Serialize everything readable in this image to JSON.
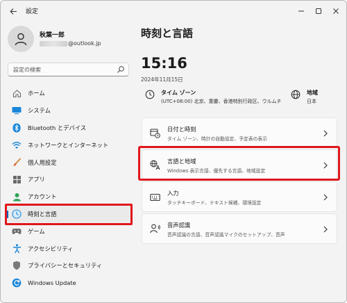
{
  "window": {
    "title": "設定"
  },
  "profile": {
    "name": "秋葉一郎",
    "email_visible": "@outlook.jp"
  },
  "search": {
    "placeholder": "設定の検索"
  },
  "sidebar": {
    "items": [
      {
        "label": "ホーム",
        "icon": "home-icon"
      },
      {
        "label": "システム",
        "icon": "system-monitor-icon"
      },
      {
        "label": "Bluetooth とデバイス",
        "icon": "bluetooth-icon"
      },
      {
        "label": "ネットワークとインターネット",
        "icon": "wifi-icon"
      },
      {
        "label": "個人用設定",
        "icon": "brush-icon"
      },
      {
        "label": "アプリ",
        "icon": "apps-icon"
      },
      {
        "label": "アカウント",
        "icon": "account-icon"
      },
      {
        "label": "時刻と言語",
        "icon": "time-language-icon",
        "active": true
      },
      {
        "label": "ゲーム",
        "icon": "game-controller-icon"
      },
      {
        "label": "アクセシビリティ",
        "icon": "accessibility-icon"
      },
      {
        "label": "プライバシーとセキュリティ",
        "icon": "shield-icon"
      },
      {
        "label": "Windows Update",
        "icon": "windows-update-icon"
      }
    ]
  },
  "main": {
    "title": "時刻と言語",
    "time": "15:16",
    "date": "2024年11月15日",
    "timezone": {
      "title": "タイム ゾーン",
      "value": "(UTC+08:00) 北京、重慶、香港特別行政区、ウルムチ"
    },
    "region": {
      "title": "地域",
      "value": "日本"
    },
    "cards": [
      {
        "title": "日付と時刻",
        "subtitle": "タイム ゾーン、時計の自動設定、予定表の表示",
        "icon": "calendar-clock-icon"
      },
      {
        "title": "言語と地域",
        "subtitle": "Windows 表示言語、優先する言語、地域設定",
        "icon": "language-region-icon"
      },
      {
        "title": "入力",
        "subtitle": "タッチキーボード、テキスト候補、環境設定",
        "icon": "keyboard-icon"
      },
      {
        "title": "音声認識",
        "subtitle": "音声認識の言語、音声認識マイクのセットアップ、音声",
        "icon": "microphone-icon"
      }
    ]
  },
  "colors": {
    "accent": "#0067c0",
    "highlight": "#e0161c"
  }
}
